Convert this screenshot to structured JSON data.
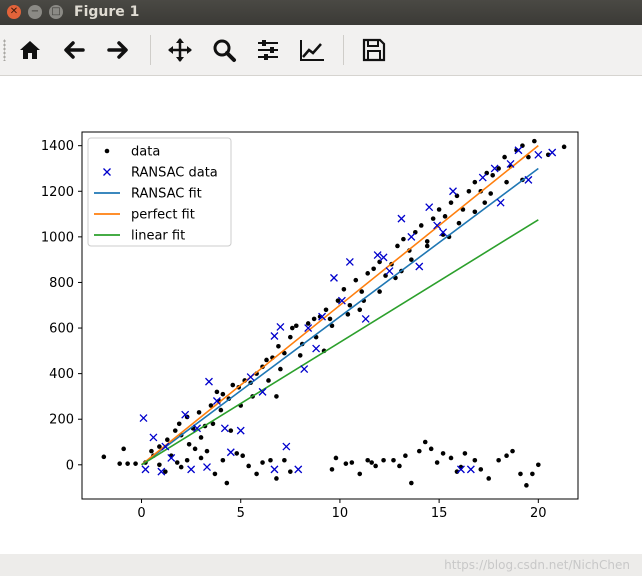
{
  "window": {
    "title": "Figure 1"
  },
  "toolbar": {
    "buttons": [
      {
        "name": "home",
        "icon": "home-icon"
      },
      {
        "name": "back",
        "icon": "arrow-left-icon"
      },
      {
        "name": "forward",
        "icon": "arrow-right-icon"
      },
      {
        "name": "pan",
        "icon": "move-icon"
      },
      {
        "name": "zoom",
        "icon": "zoom-icon"
      },
      {
        "name": "configure-subplots",
        "icon": "sliders-icon"
      },
      {
        "name": "edit-axis",
        "icon": "chart-icon"
      },
      {
        "name": "save",
        "icon": "floppy-icon"
      }
    ]
  },
  "chart_data": {
    "type": "scatter",
    "xlim": [
      -3,
      22
    ],
    "ylim": [
      -150,
      1460
    ],
    "x_ticks": [
      0,
      5,
      10,
      15,
      20
    ],
    "y_ticks": [
      0,
      200,
      400,
      600,
      800,
      1000,
      1200,
      1400
    ],
    "legend": {
      "placement": "top-left",
      "entries": [
        {
          "label": "data",
          "marker": "dot",
          "color": "#000000"
        },
        {
          "label": "RANSAC data",
          "marker": "x",
          "color": "#0000cc"
        },
        {
          "label": "RANSAC fit",
          "marker": "line",
          "color": "#1f77b4"
        },
        {
          "label": "perfect fit",
          "marker": "line",
          "color": "#ff7f0e"
        },
        {
          "label": "linear fit",
          "marker": "line",
          "color": "#2ca02c"
        }
      ]
    },
    "lines": [
      {
        "label": "RANSAC fit",
        "color": "#1f77b4",
        "x": [
          0,
          20
        ],
        "y": [
          0,
          1300
        ]
      },
      {
        "label": "perfect fit",
        "color": "#ff7f0e",
        "x": [
          0,
          20
        ],
        "y": [
          0,
          1400
        ]
      },
      {
        "label": "linear fit",
        "color": "#2ca02c",
        "x": [
          0,
          20
        ],
        "y": [
          0,
          1075
        ]
      }
    ],
    "data_points": [
      [
        -1.9,
        35
      ],
      [
        -1.1,
        5
      ],
      [
        -0.9,
        70
      ],
      [
        -0.7,
        5
      ],
      [
        -0.3,
        5
      ],
      [
        0.2,
        10
      ],
      [
        0.5,
        60
      ],
      [
        0.9,
        0
      ],
      [
        1.2,
        -30
      ],
      [
        1.5,
        40
      ],
      [
        1.8,
        10
      ],
      [
        2.0,
        -10
      ],
      [
        2.3,
        20
      ],
      [
        2.7,
        70
      ],
      [
        3.0,
        30
      ],
      [
        3.3,
        60
      ],
      [
        3.7,
        -40
      ],
      [
        4.1,
        20
      ],
      [
        4.3,
        -80
      ],
      [
        4.8,
        50
      ],
      [
        5.1,
        40
      ],
      [
        5.4,
        -5
      ],
      [
        5.8,
        -40
      ],
      [
        6.1,
        10
      ],
      [
        6.5,
        20
      ],
      [
        6.8,
        -60
      ],
      [
        7.2,
        20
      ],
      [
        7.5,
        -30
      ],
      [
        9.6,
        -20
      ],
      [
        9.8,
        30
      ],
      [
        10.3,
        5
      ],
      [
        10.6,
        10
      ],
      [
        11.0,
        -40
      ],
      [
        11.4,
        20
      ],
      [
        11.8,
        -5
      ],
      [
        12.2,
        20
      ],
      [
        12.7,
        20
      ],
      [
        13.3,
        40
      ],
      [
        13.6,
        -80
      ],
      [
        14.0,
        60
      ],
      [
        14.3,
        100
      ],
      [
        14.6,
        70
      ],
      [
        14.9,
        10
      ],
      [
        15.2,
        50
      ],
      [
        15.6,
        30
      ],
      [
        15.9,
        -30
      ],
      [
        16.3,
        50
      ],
      [
        16.8,
        20
      ],
      [
        17.1,
        -20
      ],
      [
        17.5,
        -60
      ],
      [
        18.0,
        20
      ],
      [
        18.4,
        40
      ],
      [
        18.7,
        60
      ],
      [
        19.1,
        -40
      ],
      [
        19.4,
        -90
      ],
      [
        19.7,
        -40
      ],
      [
        20.0,
        0
      ],
      [
        16.1,
        -10
      ],
      [
        13.0,
        -5
      ],
      [
        11.6,
        10
      ],
      [
        0.6,
        40
      ],
      [
        0.9,
        80
      ],
      [
        1.3,
        110
      ],
      [
        1.7,
        150
      ],
      [
        2.0,
        130
      ],
      [
        2.3,
        210
      ],
      [
        2.6,
        160
      ],
      [
        2.9,
        230
      ],
      [
        3.2,
        170
      ],
      [
        3.5,
        260
      ],
      [
        3.9,
        280
      ],
      [
        4.1,
        310
      ],
      [
        4.4,
        290
      ],
      [
        4.6,
        350
      ],
      [
        4.9,
        340
      ],
      [
        5.2,
        370
      ],
      [
        5.5,
        360
      ],
      [
        5.8,
        400
      ],
      [
        6.1,
        430
      ],
      [
        6.3,
        460
      ],
      [
        6.6,
        470
      ],
      [
        6.9,
        520
      ],
      [
        7.2,
        490
      ],
      [
        7.5,
        560
      ],
      [
        7.8,
        610
      ],
      [
        8.1,
        530
      ],
      [
        8.4,
        620
      ],
      [
        8.7,
        640
      ],
      [
        9.0,
        650
      ],
      [
        9.3,
        680
      ],
      [
        9.6,
        610
      ],
      [
        9.9,
        720
      ],
      [
        10.2,
        770
      ],
      [
        10.5,
        700
      ],
      [
        10.8,
        810
      ],
      [
        11.1,
        760
      ],
      [
        11.4,
        840
      ],
      [
        11.7,
        860
      ],
      [
        12.0,
        890
      ],
      [
        12.3,
        830
      ],
      [
        12.6,
        880
      ],
      [
        12.9,
        960
      ],
      [
        13.2,
        990
      ],
      [
        13.5,
        940
      ],
      [
        13.8,
        1020
      ],
      [
        14.1,
        1050
      ],
      [
        14.4,
        980
      ],
      [
        14.7,
        1080
      ],
      [
        15.0,
        1120
      ],
      [
        15.3,
        1090
      ],
      [
        15.6,
        1150
      ],
      [
        15.9,
        1180
      ],
      [
        16.2,
        1120
      ],
      [
        16.5,
        1200
      ],
      [
        16.8,
        1240
      ],
      [
        17.1,
        1200
      ],
      [
        17.4,
        1280
      ],
      [
        17.7,
        1270
      ],
      [
        18.0,
        1300
      ],
      [
        18.3,
        1350
      ],
      [
        18.6,
        1310
      ],
      [
        18.9,
        1380
      ],
      [
        19.2,
        1400
      ],
      [
        19.5,
        1350
      ],
      [
        19.8,
        1420
      ],
      [
        20.5,
        1360
      ],
      [
        21.3,
        1395
      ],
      [
        3.0,
        120
      ],
      [
        3.6,
        180
      ],
      [
        4.0,
        240
      ],
      [
        5.0,
        260
      ],
      [
        5.6,
        300
      ],
      [
        6.4,
        370
      ],
      [
        7.0,
        420
      ],
      [
        8.0,
        480
      ],
      [
        8.8,
        560
      ],
      [
        9.5,
        640
      ],
      [
        10.4,
        660
      ],
      [
        11.2,
        720
      ],
      [
        12.0,
        760
      ],
      [
        12.8,
        820
      ],
      [
        13.6,
        900
      ],
      [
        14.4,
        960
      ],
      [
        15.2,
        1010
      ],
      [
        16.0,
        1060
      ],
      [
        16.8,
        1110
      ],
      [
        17.6,
        1190
      ],
      [
        18.4,
        1240
      ],
      [
        19.2,
        1250
      ],
      [
        2.4,
        90
      ],
      [
        1.9,
        180
      ],
      [
        4.5,
        150
      ],
      [
        6.8,
        300
      ],
      [
        9.2,
        500
      ],
      [
        11.0,
        680
      ],
      [
        13.1,
        850
      ],
      [
        15.5,
        1000
      ],
      [
        17.3,
        1150
      ],
      [
        3.8,
        320
      ],
      [
        7.6,
        600
      ]
    ],
    "ransac_points": [
      [
        0.1,
        205
      ],
      [
        0.6,
        120
      ],
      [
        1.2,
        80
      ],
      [
        1.5,
        30
      ],
      [
        2.2,
        220
      ],
      [
        2.8,
        160
      ],
      [
        3.4,
        365
      ],
      [
        3.8,
        280
      ],
      [
        4.5,
        55
      ],
      [
        5.0,
        150
      ],
      [
        5.5,
        385
      ],
      [
        6.1,
        320
      ],
      [
        6.7,
        565
      ],
      [
        7.0,
        605
      ],
      [
        7.3,
        80
      ],
      [
        7.9,
        -20
      ],
      [
        8.4,
        600
      ],
      [
        8.8,
        510
      ],
      [
        9.7,
        820
      ],
      [
        10.5,
        890
      ],
      [
        11.3,
        640
      ],
      [
        11.9,
        920
      ],
      [
        12.5,
        850
      ],
      [
        13.1,
        1080
      ],
      [
        13.6,
        1000
      ],
      [
        14.0,
        870
      ],
      [
        14.5,
        1130
      ],
      [
        15.2,
        1020
      ],
      [
        15.7,
        1200
      ],
      [
        16.1,
        -20
      ],
      [
        16.6,
        -20
      ],
      [
        17.2,
        1260
      ],
      [
        17.8,
        1300
      ],
      [
        18.1,
        1150
      ],
      [
        18.6,
        1320
      ],
      [
        19.0,
        1380
      ],
      [
        19.5,
        1250
      ],
      [
        20.0,
        1360
      ],
      [
        20.7,
        1370
      ],
      [
        0.2,
        -20
      ],
      [
        1.0,
        -30
      ],
      [
        2.5,
        -20
      ],
      [
        3.3,
        -10
      ],
      [
        6.7,
        -20
      ],
      [
        4.2,
        160
      ],
      [
        8.2,
        420
      ],
      [
        9.1,
        650
      ],
      [
        10.1,
        720
      ],
      [
        12.2,
        910
      ],
      [
        14.9,
        1050
      ]
    ]
  }
}
